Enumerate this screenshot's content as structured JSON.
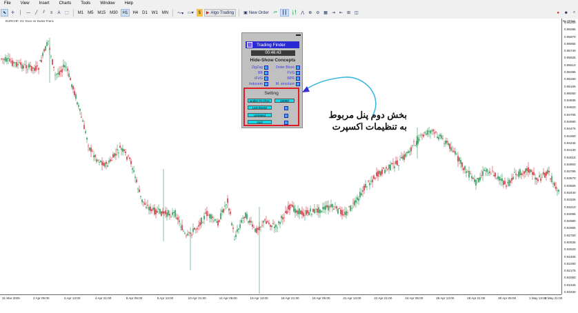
{
  "menu": [
    "File",
    "View",
    "Insert",
    "Charts",
    "Tools",
    "Window",
    "Help"
  ],
  "toolbar": {
    "timeframes": [
      "M1",
      "M5",
      "M15",
      "M30",
      "H1",
      "H4",
      "D1",
      "W1",
      "MN"
    ],
    "active_timeframe": "H1",
    "algo_label": "Algo Trading",
    "new_order_label": "New Order"
  },
  "chart": {
    "symbol_text": "EURCHF, H1:  Euro vs Swiss Franc",
    "tf_pill": "By TFlab",
    "price_labels": [
      "0.96200",
      "0.96085",
      "0.95970",
      "0.95855",
      "0.95740",
      "0.95625",
      "0.95510",
      "0.95395",
      "0.95280",
      "0.95165",
      "0.95050",
      "0.94935",
      "0.94820",
      "0.94705",
      "0.94590",
      "0.94475",
      "0.94360",
      "0.94245",
      "0.94130",
      "0.94015",
      "0.93900",
      "0.93785",
      "0.93670",
      "0.93555",
      "0.93440",
      "0.93325",
      "0.93210",
      "0.93095",
      "0.92980",
      "0.92865",
      "0.92750",
      "0.92635",
      "0.92520",
      "0.92405",
      "0.92290",
      "0.92175",
      "0.92060",
      "0.91945",
      "0.91830"
    ],
    "time_labels": [
      "31 Mar 2025",
      "2 Apr 05:00",
      "3 Apr 13:00",
      "4 Apr 21:00",
      "8 Apr 05:00",
      "9 Apr 13:00",
      "10 Apr 21:00",
      "14 Apr 05:00",
      "15 Apr 13:00",
      "16 Apr 21:00",
      "18 Apr 05:00",
      "21 Apr 13:00",
      "22 Apr 21:00",
      "24 Apr 05:00",
      "25 Apr 13:00",
      "28 Apr 21:00",
      "30 Apr 05:00",
      "1 May 13:00",
      "2 May 21:00"
    ]
  },
  "panel": {
    "logo_text": "Trading Finder",
    "timer": "00:46:43",
    "hide_show_title": "Hide-Show Concepts",
    "concepts": [
      {
        "name": "ZigZag"
      },
      {
        "name": "Order Block"
      },
      {
        "name": "BB"
      },
      {
        "name": "FVG"
      },
      {
        "name": "iFVG"
      },
      {
        "name": "BPR"
      },
      {
        "name": "Inducem"
      },
      {
        "name": "M. structure"
      }
    ],
    "setting_title": "Setting",
    "settings_buttons": [
      "andles To Chec",
      "Last Blocks",
      "Untested",
      "Void"
    ],
    "settings_value": "10000"
  },
  "annotation": {
    "line1": "بخش دوم پنل مربوط",
    "line2": "به تنظیمات اکسپرت"
  },
  "colors": {
    "bull": "#2e9b5a",
    "bear": "#d8323e",
    "accent": "#e01b24",
    "arrow": "#3ab8e0",
    "panel_bg": "#c0c0c0"
  }
}
